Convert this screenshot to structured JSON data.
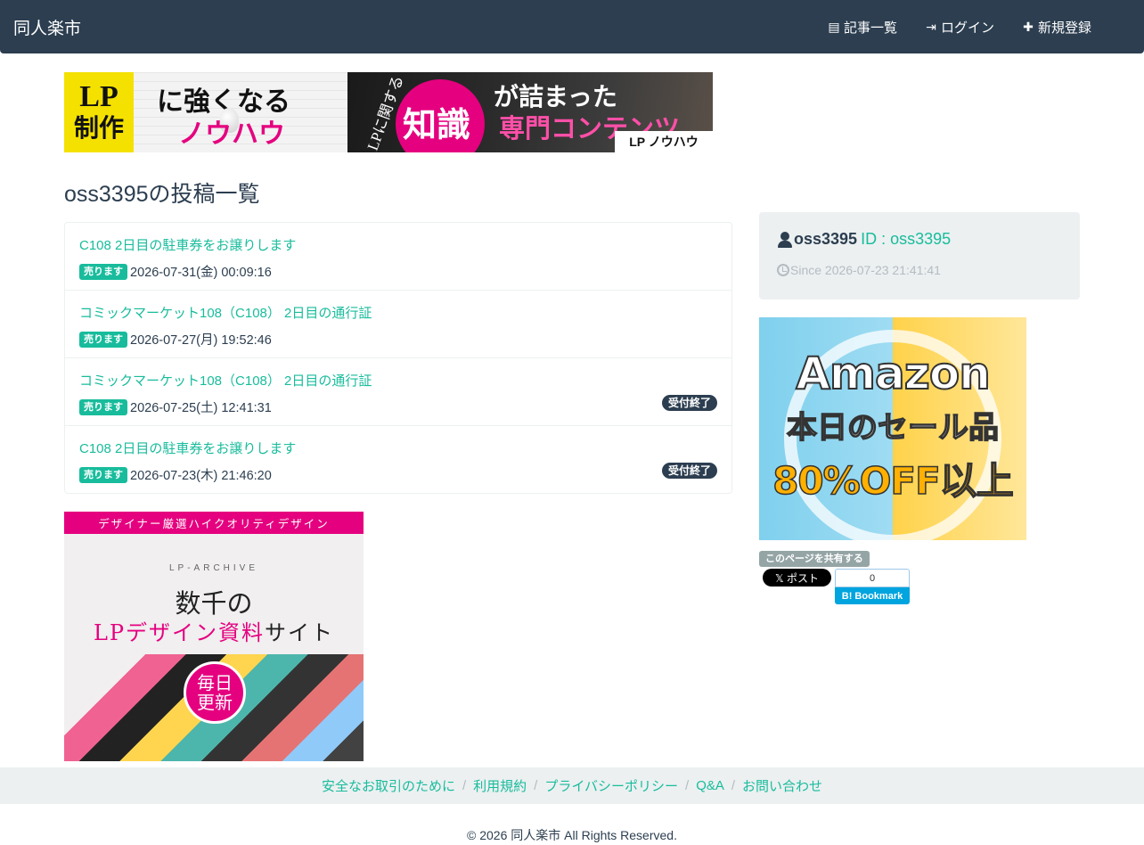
{
  "navbar": {
    "brand": "同人楽市",
    "links": [
      {
        "icon": "list-icon",
        "glyph": "▤",
        "label": "記事一覧"
      },
      {
        "icon": "login-icon",
        "glyph": "⇥",
        "label": "ログイン"
      },
      {
        "icon": "plus-icon",
        "glyph": "✚",
        "label": "新規登録"
      }
    ]
  },
  "top_banner": {
    "lp": "LP",
    "seisaku": "制作",
    "line1": "に強くなる",
    "line2": "ノウハウ",
    "side": "LPに関する",
    "chishiki": "知識",
    "ga": "が詰まった",
    "senmon": "専門コンテンツ",
    "logo": "LP ノウハウ"
  },
  "page_title": "oss3395の投稿一覧",
  "posts": [
    {
      "title": "C108 2日目の駐車券をお譲りします",
      "badge": "売ります",
      "date": "2026-07-31(金) 00:09:16",
      "status": ""
    },
    {
      "title": "コミックマーケット108（C108） 2日目の通行証",
      "badge": "売ります",
      "date": "2026-07-27(月) 19:52:46",
      "status": ""
    },
    {
      "title": "コミックマーケット108（C108） 2日目の通行証",
      "badge": "売ります",
      "date": "2026-07-25(土) 12:41:31",
      "status": "受付終了"
    },
    {
      "title": "C108 2日目の駐車券をお譲りします",
      "badge": "売ります",
      "date": "2026-07-23(木) 21:46:20",
      "status": "受付終了"
    }
  ],
  "profile": {
    "name": "oss3395",
    "id_text": "ID : oss3395",
    "since": "Since 2026-07-23 21:41:41"
  },
  "amazon_banner": {
    "line1": "Amazon",
    "line2": "本日のセール品",
    "line3": "80%OFF以上"
  },
  "share": {
    "label": "このページを共有する",
    "x_post": "𝕏 ポスト",
    "hatena_count": "0",
    "hatena_label": "B! Bookmark"
  },
  "lp_archive_banner": {
    "top": "デザイナー厳選ハイクオリティデザイン",
    "name": "LP-ARCHIVE",
    "h1": "数千の",
    "h2a": "LPデザイン",
    "h2b": "資料",
    "h2c": "サイト",
    "stamp1": "毎日",
    "stamp2": "更新"
  },
  "footer": {
    "links": [
      "安全なお取引のために",
      "利用規約",
      "プライバシーポリシー",
      "Q&A",
      "お問い合わせ"
    ],
    "copyright": "© 2026 同人楽市 All Rights Reserved."
  },
  "colors": {
    "navbar": "#2c3e50",
    "accent": "#18bc9c",
    "panel": "#ecf0f1",
    "pink": "#e5007f"
  }
}
